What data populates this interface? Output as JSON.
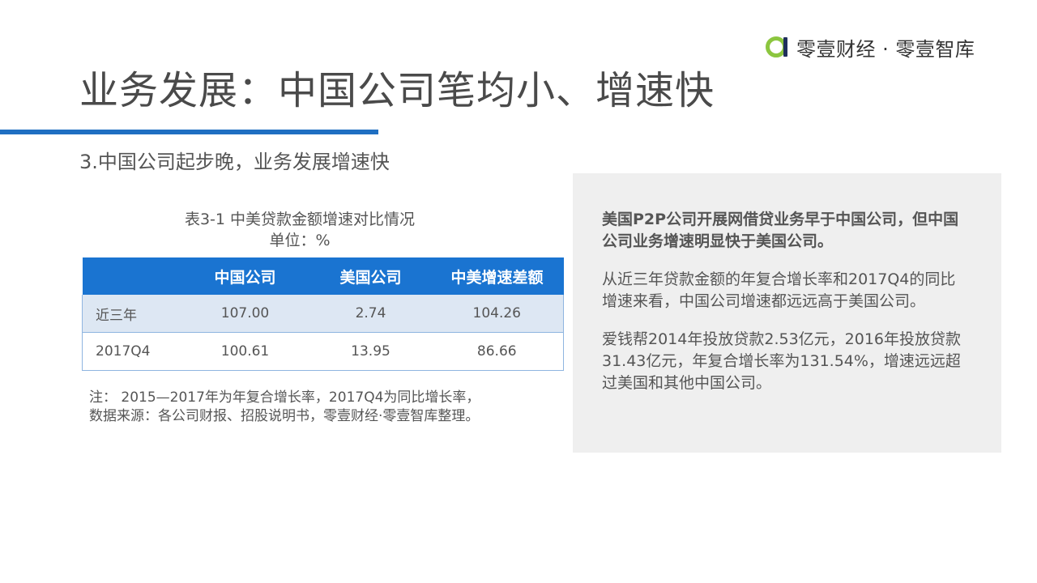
{
  "brand": {
    "name": "零壹财经 · 零壹智库",
    "accent": "#8cc63f"
  },
  "title": "业务发展：中国公司笔均小、增速快",
  "subtitle": "3.中国公司起步晚，业务发展增速快",
  "table": {
    "caption_line1": "表3-1  中美贷款金额增速对比情况",
    "caption_line2": "单位：%",
    "headers": [
      "",
      "中国公司",
      "美国公司",
      "中美增速差额"
    ],
    "rows": [
      [
        "近三年",
        "107.00",
        "2.74",
        "104.26"
      ],
      [
        "2017Q4",
        "100.61",
        "13.95",
        "86.66"
      ]
    ],
    "header_bg": "#1a74d1"
  },
  "notes": {
    "line1": "注： 2015—2017年为年复合增长率，2017Q4为同比增长率，",
    "line2": "数据来源：各公司财报、招股说明书，零壹财经·零壹智库整理。"
  },
  "panel": {
    "lead": "美国P2P公司开展网借贷业务早于中国公司，但中国公司业务增速明显快于美国公司。",
    "para2": "从近三年贷款金额的年复合增长率和2017Q4的同比增速来看，中国公司增速都远远高于美国公司。",
    "para3": "爱钱帮2014年投放贷款2.53亿元，2016年投放贷款31.43亿元，年复合增长率为131.54%，增速远远超过美国和其他中国公司。"
  },
  "colors": {
    "title_bar": "#1f6fc2",
    "panel_bg": "#efefef"
  }
}
